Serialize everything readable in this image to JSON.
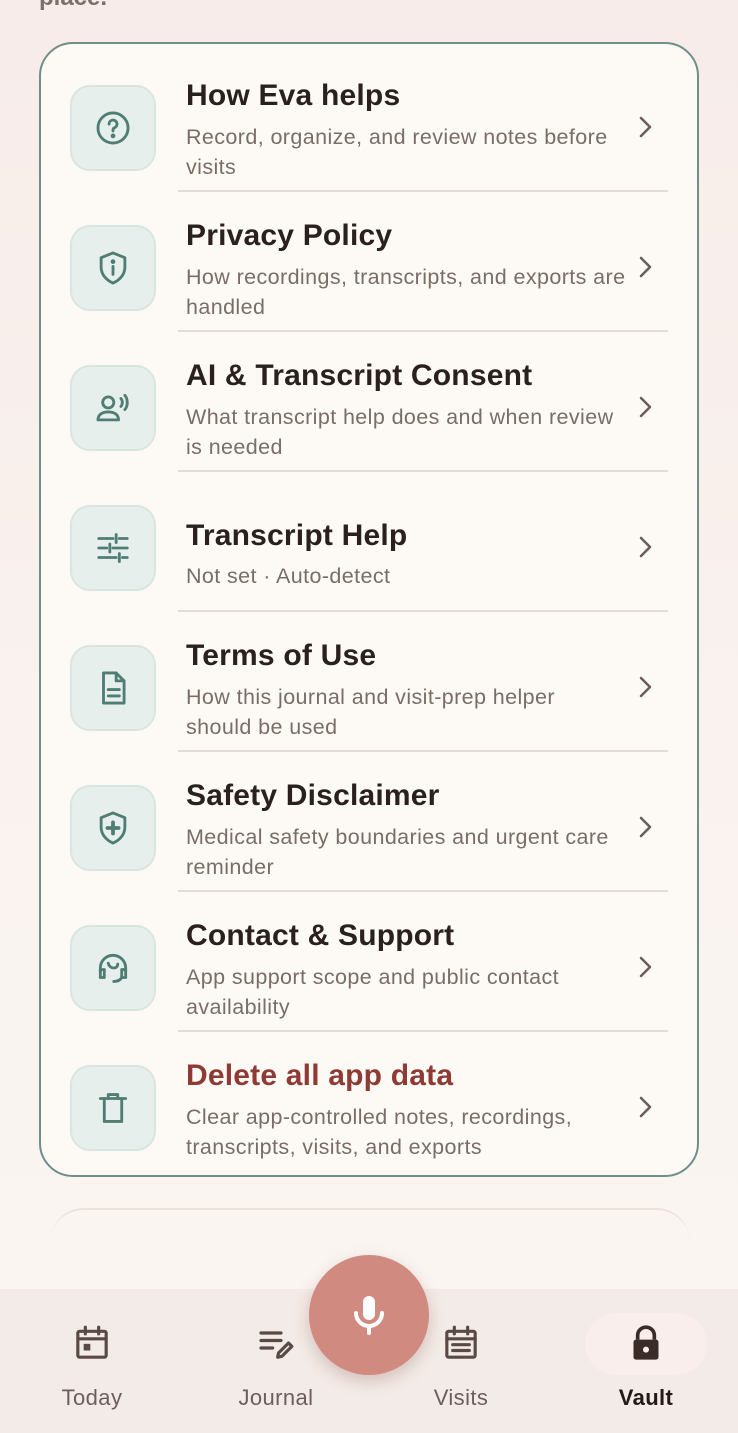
{
  "header": {
    "partial_text": "place."
  },
  "menu": {
    "items": [
      {
        "title": "How Eva helps",
        "subtitle": "Record, organize, and review notes before visits",
        "icon": "help-circle-icon"
      },
      {
        "title": "Privacy Policy",
        "subtitle": "How recordings, transcripts, and exports are handled",
        "icon": "shield-info-icon"
      },
      {
        "title": "AI & Transcript Consent",
        "subtitle": "What transcript help does and when review is needed",
        "icon": "voice-person-icon"
      },
      {
        "title": "Transcript Help",
        "subtitle": "Not set · Auto-detect",
        "icon": "sliders-icon"
      },
      {
        "title": "Terms of Use",
        "subtitle": "How this journal and visit-prep helper should be used",
        "icon": "document-icon"
      },
      {
        "title": "Safety Disclaimer",
        "subtitle": "Medical safety boundaries and urgent care reminder",
        "icon": "shield-plus-icon"
      },
      {
        "title": "Contact & Support",
        "subtitle": "App support scope and public contact availability",
        "icon": "headset-icon"
      },
      {
        "title": "Delete all app data",
        "subtitle": "Clear app-controlled notes, recordings, transcripts, visits, and exports",
        "icon": "trash-icon"
      }
    ]
  },
  "bottom_nav": {
    "items": [
      {
        "label": "Today",
        "icon": "calendar-icon"
      },
      {
        "label": "Journal",
        "icon": "journal-edit-icon"
      },
      {
        "label": "Visits",
        "icon": "visits-list-icon"
      },
      {
        "label": "Vault",
        "icon": "lock-icon",
        "active": true
      }
    ],
    "fab_icon": "microphone-icon"
  },
  "colors": {
    "accent": "#6f8f88",
    "danger": "#8d3b34",
    "fab": "#d08a80",
    "icon_tint": "#4f7d74"
  }
}
